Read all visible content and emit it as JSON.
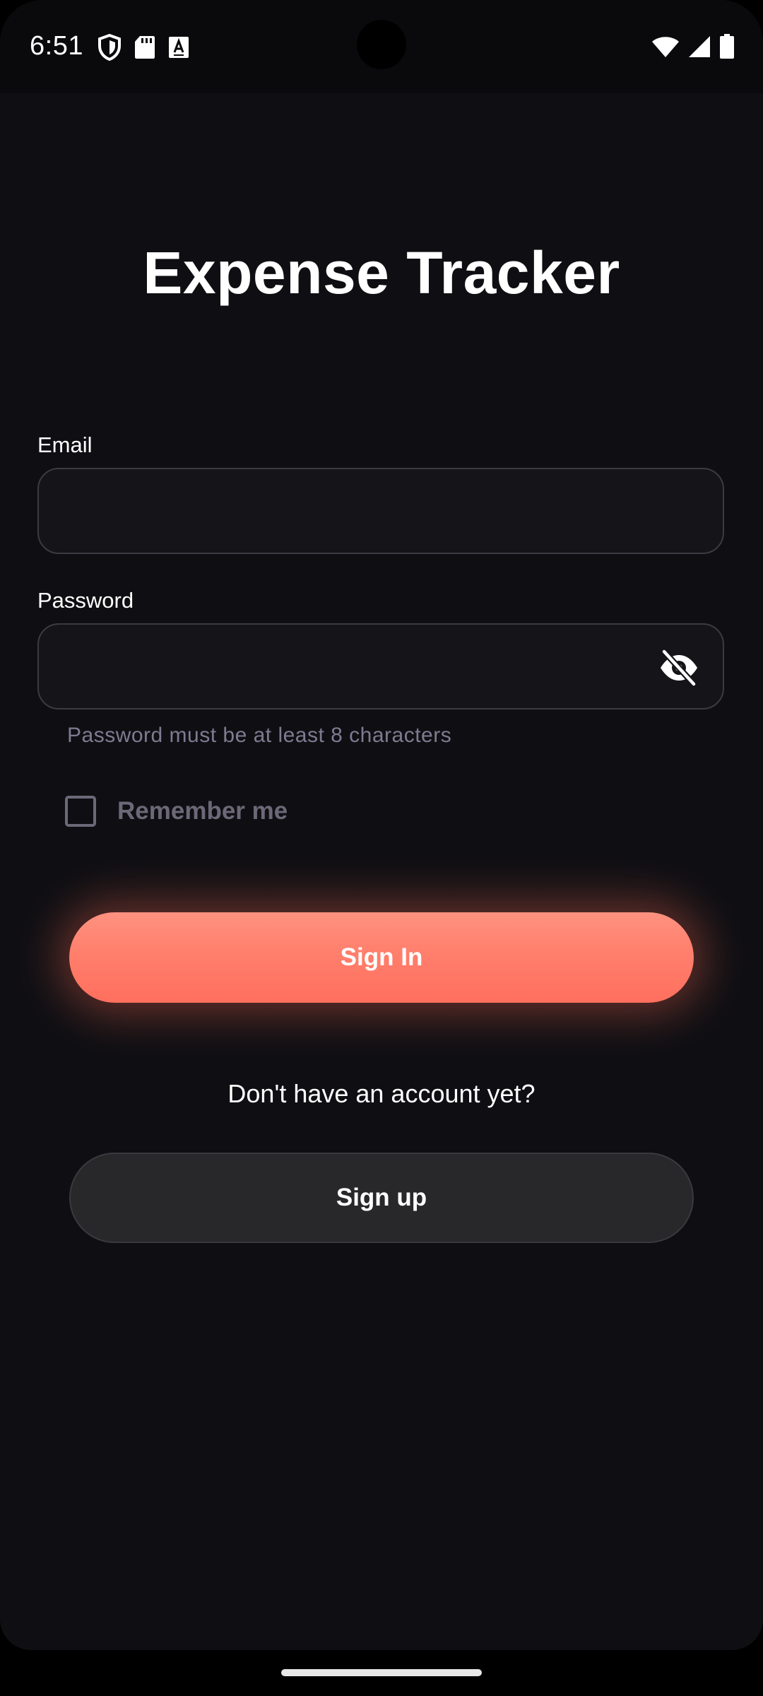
{
  "status_bar": {
    "time": "6:51",
    "left_icons": [
      "shield-icon",
      "sd-card-icon",
      "text-a-icon"
    ],
    "right_icons": [
      "wifi-icon",
      "signal-icon",
      "battery-icon"
    ]
  },
  "app": {
    "title": "Expense Tracker"
  },
  "form": {
    "email": {
      "label": "Email",
      "value": "",
      "placeholder": ""
    },
    "password": {
      "label": "Password",
      "value": "",
      "placeholder": "",
      "helper": "Password must be at least 8 characters",
      "toggle_icon": "eye-off-icon"
    },
    "remember": {
      "label": "Remember me",
      "checked": false
    }
  },
  "actions": {
    "sign_in_label": "Sign In",
    "no_account_text": "Don't have an account yet?",
    "sign_up_label": "Sign up"
  },
  "colors": {
    "background": "#0f0f13",
    "accent": "#ff7f6c",
    "field_border": "#3c3a42",
    "muted_text": "#7f7a91",
    "secondary_button": "#28282b"
  }
}
